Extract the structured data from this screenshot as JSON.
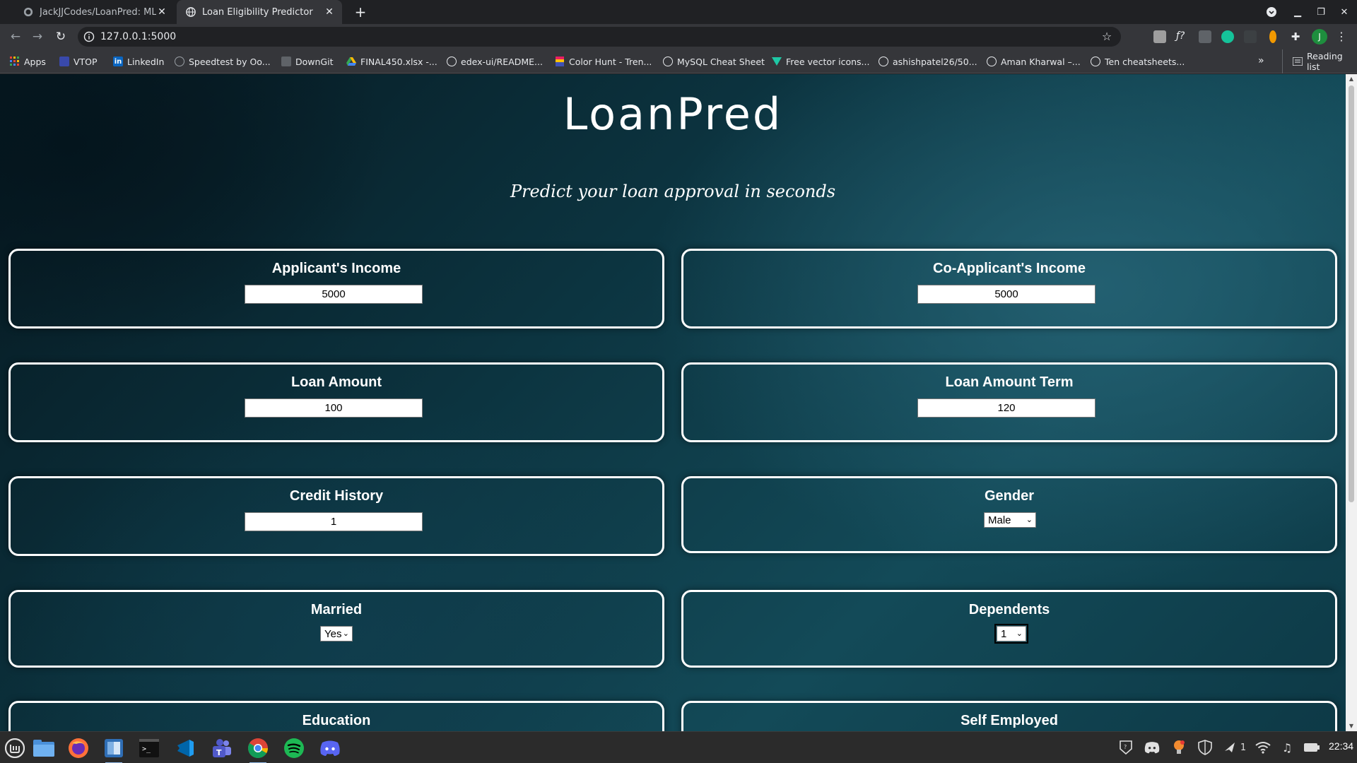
{
  "browser": {
    "tabs": [
      {
        "title": "JackJJCodes/LoanPred: ML-b",
        "favicon": "github-icon",
        "active": false
      },
      {
        "title": "Loan Eligibility Predictor",
        "favicon": "globe-icon",
        "active": true
      }
    ],
    "url": "127.0.0.1:5000",
    "bookmarks": [
      {
        "label": "Apps",
        "icon": "apps-grid-icon"
      },
      {
        "label": "VTOP",
        "icon": "vtop-icon"
      },
      {
        "label": "LinkedIn",
        "icon": "linkedin-icon"
      },
      {
        "label": "Speedtest by Oo...",
        "icon": "speedtest-icon"
      },
      {
        "label": "DownGit",
        "icon": "downgit-icon"
      },
      {
        "label": "FINAL450.xlsx -...",
        "icon": "google-drive-icon"
      },
      {
        "label": "edex-ui/README...",
        "icon": "github-icon"
      },
      {
        "label": "Color Hunt - Tren...",
        "icon": "color-hunt-icon"
      },
      {
        "label": "MySQL Cheat Sheet",
        "icon": "github-icon"
      },
      {
        "label": "Free vector icons...",
        "icon": "flaticon-icon"
      },
      {
        "label": "ashishpatel26/50...",
        "icon": "github-icon"
      },
      {
        "label": "Aman Kharwal –...",
        "icon": "globe-icon"
      },
      {
        "label": "Ten cheatsheets...",
        "icon": "globe-icon"
      }
    ],
    "bookmarks_more": "»",
    "reading_list": "Reading list",
    "profile_initial": "J"
  },
  "page": {
    "title": "LoanPred",
    "subtitle": "Predict your loan approval in seconds",
    "fields": {
      "applicant_income": {
        "label": "Applicant's Income",
        "value": "5000"
      },
      "coapplicant_income": {
        "label": "Co-Applicant's Income",
        "value": "5000"
      },
      "loan_amount": {
        "label": "Loan Amount",
        "value": "100"
      },
      "loan_amount_term": {
        "label": "Loan Amount Term",
        "value": "120"
      },
      "credit_history": {
        "label": "Credit History",
        "value": "1"
      },
      "gender": {
        "label": "Gender",
        "value": "Male"
      },
      "married": {
        "label": "Married",
        "value": "Yes"
      },
      "dependents": {
        "label": "Dependents",
        "value": "1"
      },
      "education": {
        "label": "Education"
      },
      "self_employed": {
        "label": "Self Employed"
      }
    }
  },
  "taskbar": {
    "apps": [
      "linux-mint-menu-icon",
      "files-icon",
      "firefox-icon",
      "nemo-icon",
      "terminal-icon",
      "vscode-icon",
      "teams-icon",
      "chrome-icon",
      "spotify-icon",
      "discord-icon"
    ],
    "workspace_number": "1",
    "clock": "22:34"
  },
  "colors": {
    "accent_border": "#ffffff",
    "page_bg_dark": "#061820",
    "page_bg_light": "#134a58"
  }
}
